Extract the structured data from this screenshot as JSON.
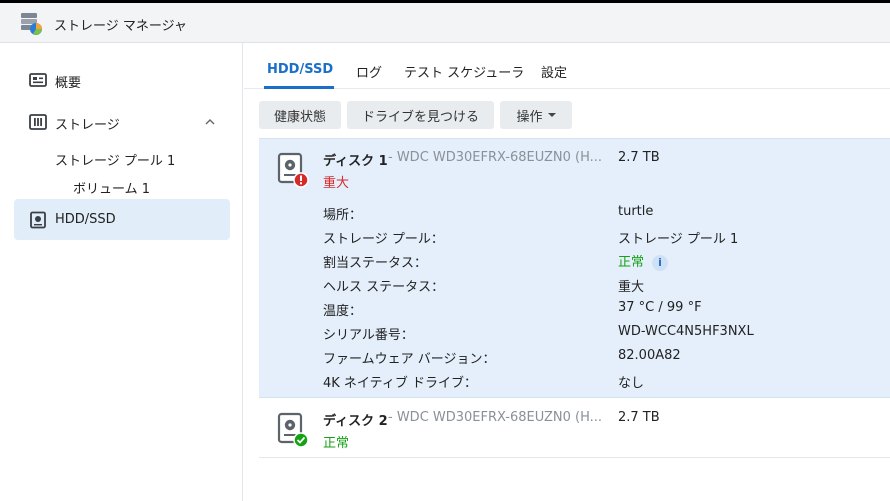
{
  "window": {
    "title": "ストレージ マネージャ"
  },
  "sidebar": {
    "items": [
      {
        "label": "概要"
      },
      {
        "label": "ストレージ"
      },
      {
        "label": "ストレージ プール 1"
      },
      {
        "label": "ボリューム 1"
      },
      {
        "label": "HDD/SSD"
      }
    ]
  },
  "tabs": [
    {
      "label": "HDD/SSD"
    },
    {
      "label": "ログ"
    },
    {
      "label": "テスト スケジューラ"
    },
    {
      "label": "設定"
    }
  ],
  "toolbar": {
    "health_label": "健康状態",
    "locate_label": "ドライブを見つける",
    "actions_label": "操作"
  },
  "disks": [
    {
      "name": "ディスク 1",
      "model": " - WDC WD30EFRX-68EUZN0 (H...",
      "size": "2.7 TB",
      "status": "重大",
      "details": [
        {
          "label": "場所：",
          "value": "turtle"
        },
        {
          "label": "ストレージ プール：",
          "value": "ストレージ プール 1"
        },
        {
          "label": "割当ステータス：",
          "value": "正常"
        },
        {
          "label": "ヘルス ステータス：",
          "value": "重大"
        },
        {
          "label": "温度：",
          "value": "37 °C / 99 °F"
        },
        {
          "label": "シリアル番号：",
          "value": "WD-WCC4N5HF3NXL"
        },
        {
          "label": "ファームウェア バージョン：",
          "value": "82.00A82"
        },
        {
          "label": "4K ネイティブ ドライブ：",
          "value": "なし"
        }
      ],
      "info_glyph": "i"
    },
    {
      "name": "ディスク 2",
      "model": " - WDC WD30EFRX-68EUZN0 (H...",
      "size": "2.7 TB",
      "status": "正常"
    }
  ],
  "colors": {
    "accent": "#1a6fc9",
    "selected_bg": "#e4effb",
    "critical": "#d62a2a",
    "normal": "#14a114"
  },
  "icons": [
    "storage-manager-app-icon",
    "overview-icon",
    "storage-icon",
    "chevron-up-icon",
    "hdd-icon",
    "disk-critical-icon",
    "disk-ok-icon",
    "info-icon"
  ]
}
